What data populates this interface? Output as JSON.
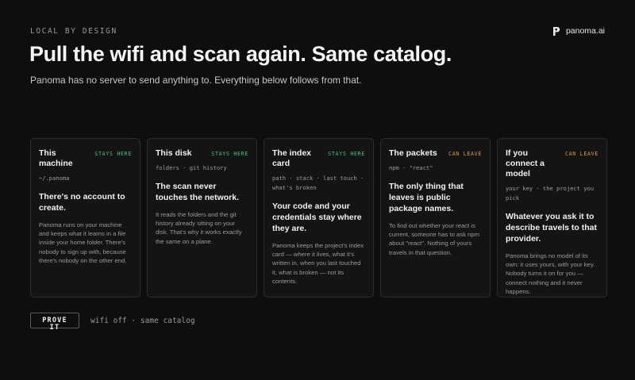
{
  "header": {
    "eyebrow": "LOCAL BY DESIGN",
    "brand_name": "panoma.ai",
    "brand_icon": "panoma-logo-icon",
    "title": "Pull the wifi and scan again. Same catalog.",
    "subtitle": "Panoma has no server to send anything to. Everything below follows from that."
  },
  "colors": {
    "stays_here": "#4bc07e",
    "can_leave": "#e0982e",
    "background": "#0e0e0e",
    "card": "#141414"
  },
  "cards": [
    {
      "title": "This machine",
      "badge": "STAYS HERE",
      "badge_kind": "stay",
      "meta": "~/.panoma",
      "lead": "There's no account to create.",
      "body": "Panoma runs on your machine and keeps what it learns in a file inside your home folder. There's nobody to sign up with, because there's nobody on the other end."
    },
    {
      "title": "This disk",
      "badge": "STAYS HERE",
      "badge_kind": "stay",
      "meta": "folders · git history",
      "lead": "The scan never touches the network.",
      "body": "It reads the folders and the git history already sitting on your disk. That's why it works exactly the same on a plane."
    },
    {
      "title": "The index card",
      "badge": "STAYS HERE",
      "badge_kind": "stay",
      "meta": "path · stack · last touch · what's broken",
      "lead": "Your code and your credentials stay where they are.",
      "body": "Panoma keeps the project's index card — where it lives, what it's written in, when you last touched it, what is broken — not its contents."
    },
    {
      "title": "The packets",
      "badge": "CAN LEAVE",
      "badge_kind": "leave",
      "meta": "npm · \"react\"",
      "lead": "The only thing that leaves is public package names.",
      "body": "To find out whether your react is current, someone has to ask npm about \"react\". Nothing of yours travels in that question."
    },
    {
      "title": "If you connect a model",
      "badge": "CAN LEAVE",
      "badge_kind": "leave",
      "meta": "your key · the project you pick",
      "lead": "Whatever you ask it to describe travels to that provider.",
      "body": "Panoma brings no model of its own: it uses yours, with your key. Nobody turns it on for you — connect nothing and it never happens."
    }
  ],
  "proof": {
    "button_label": "PROVE IT",
    "note": "wifi off · same catalog"
  }
}
